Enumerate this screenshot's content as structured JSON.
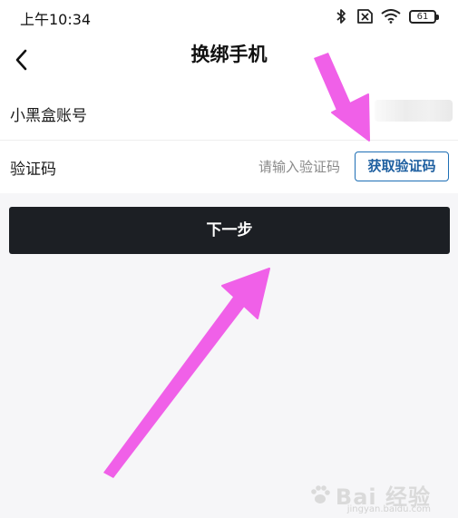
{
  "status_bar": {
    "time": "上午10:34",
    "battery_level": "61",
    "icons": [
      "bluetooth-icon",
      "no-sim-icon",
      "wifi-icon",
      "battery-icon"
    ]
  },
  "nav": {
    "title": "换绑手机",
    "back_icon": "chevron-left-icon"
  },
  "form": {
    "account_label": "小黑盒账号",
    "code_label": "验证码",
    "code_placeholder": "请输入验证码",
    "code_value": "",
    "get_code_label": "获取验证码"
  },
  "next_button_label": "下一步",
  "watermark": {
    "logo_text": "Bai 经验",
    "sub_text": "jingyan.baidu.com"
  },
  "colors": {
    "accent_blue": "#1e6fb5",
    "button_dark": "#1c1f24",
    "annotation_arrow": "#f060e8",
    "background": "#f6f6f8"
  }
}
